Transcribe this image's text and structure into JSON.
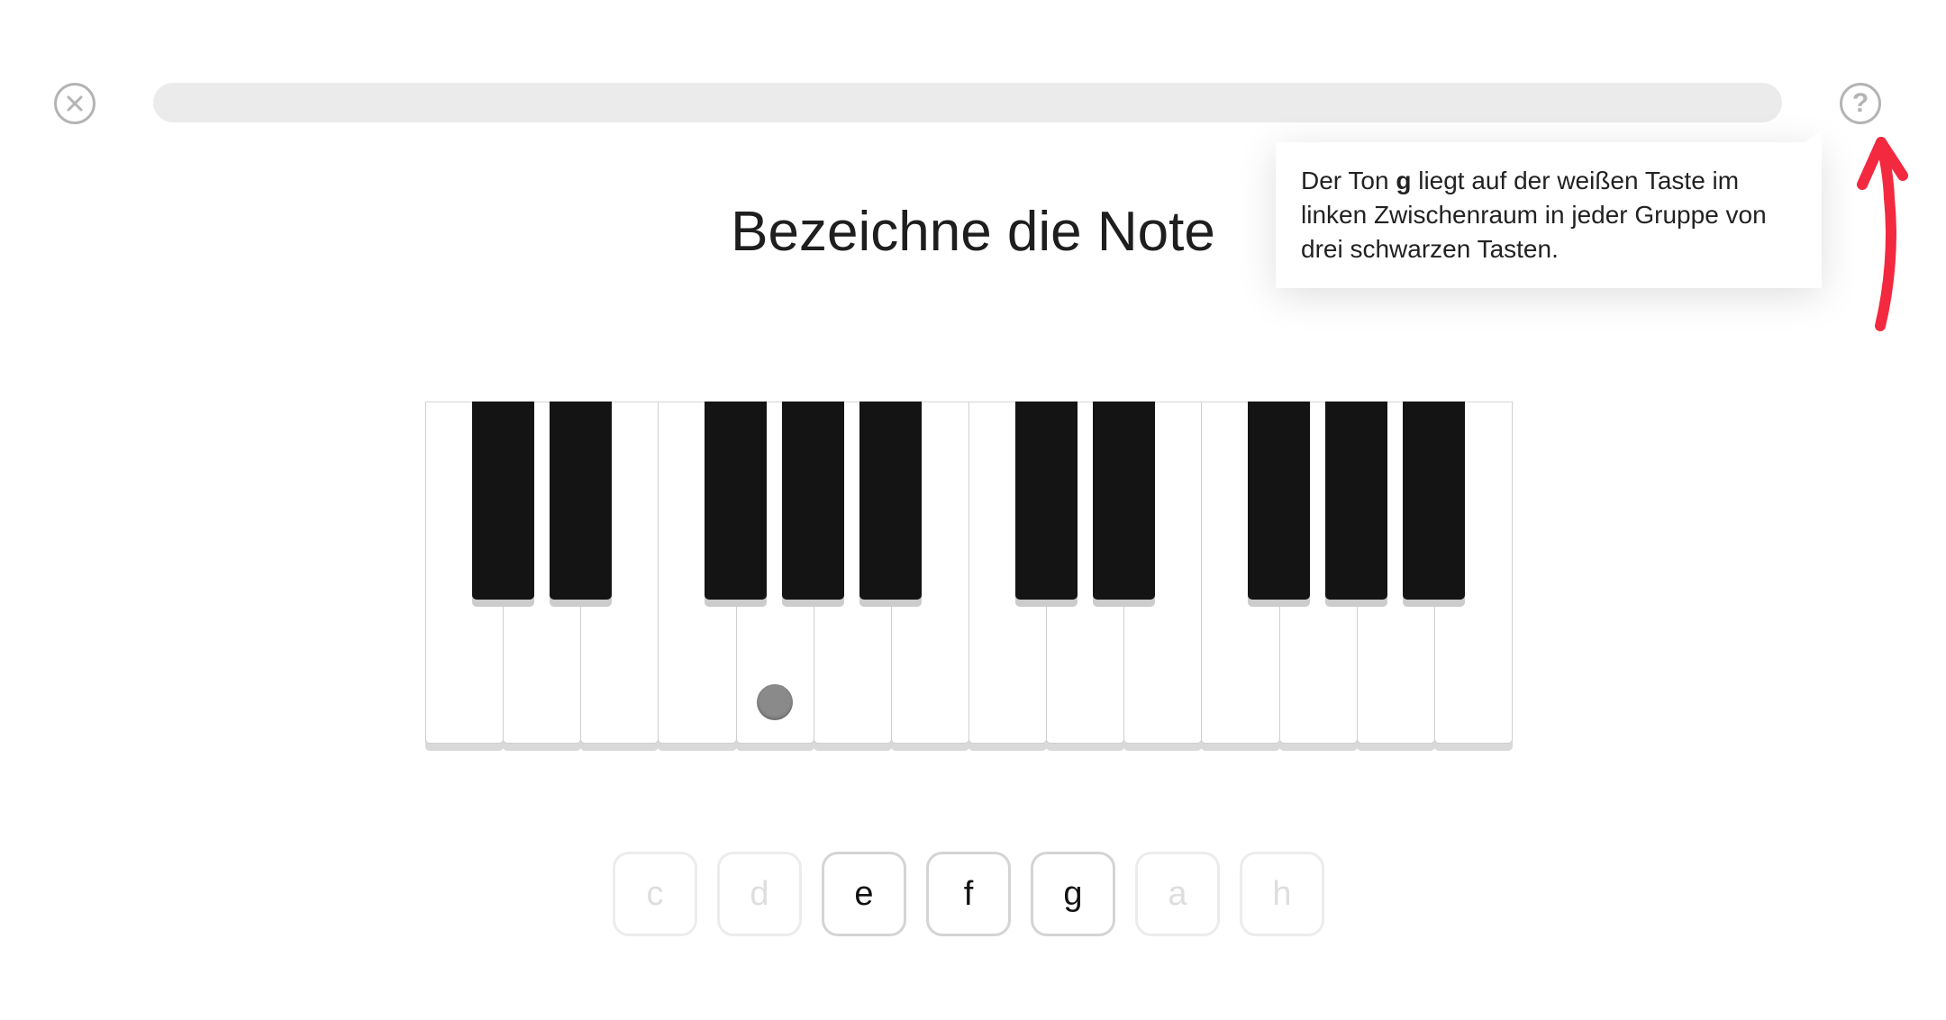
{
  "header": {
    "close_icon": "close-icon",
    "help_icon": "help-icon",
    "help_label": "?",
    "progress_fraction": 0
  },
  "tooltip": {
    "text_before": "Der Ton ",
    "text_bold": "g",
    "text_after": " liegt auf der weißen Taste im linken Zwischenraum in jeder Gruppe von drei schwarzen Tasten."
  },
  "title": "Bezeichne die Note",
  "piano": {
    "white_key_count": 14,
    "black_key_after_white_index": [
      0,
      1,
      3,
      4,
      5,
      7,
      8,
      10,
      11,
      12
    ],
    "marked_white_key_index": 4
  },
  "answers": [
    {
      "label": "c",
      "enabled": false
    },
    {
      "label": "d",
      "enabled": false
    },
    {
      "label": "e",
      "enabled": true
    },
    {
      "label": "f",
      "enabled": true
    },
    {
      "label": "g",
      "enabled": true
    },
    {
      "label": "a",
      "enabled": false
    },
    {
      "label": "h",
      "enabled": false
    }
  ],
  "colors": {
    "annotation_arrow": "#f2293f",
    "black_key": "#141414",
    "marker": "#8a8a8a"
  }
}
